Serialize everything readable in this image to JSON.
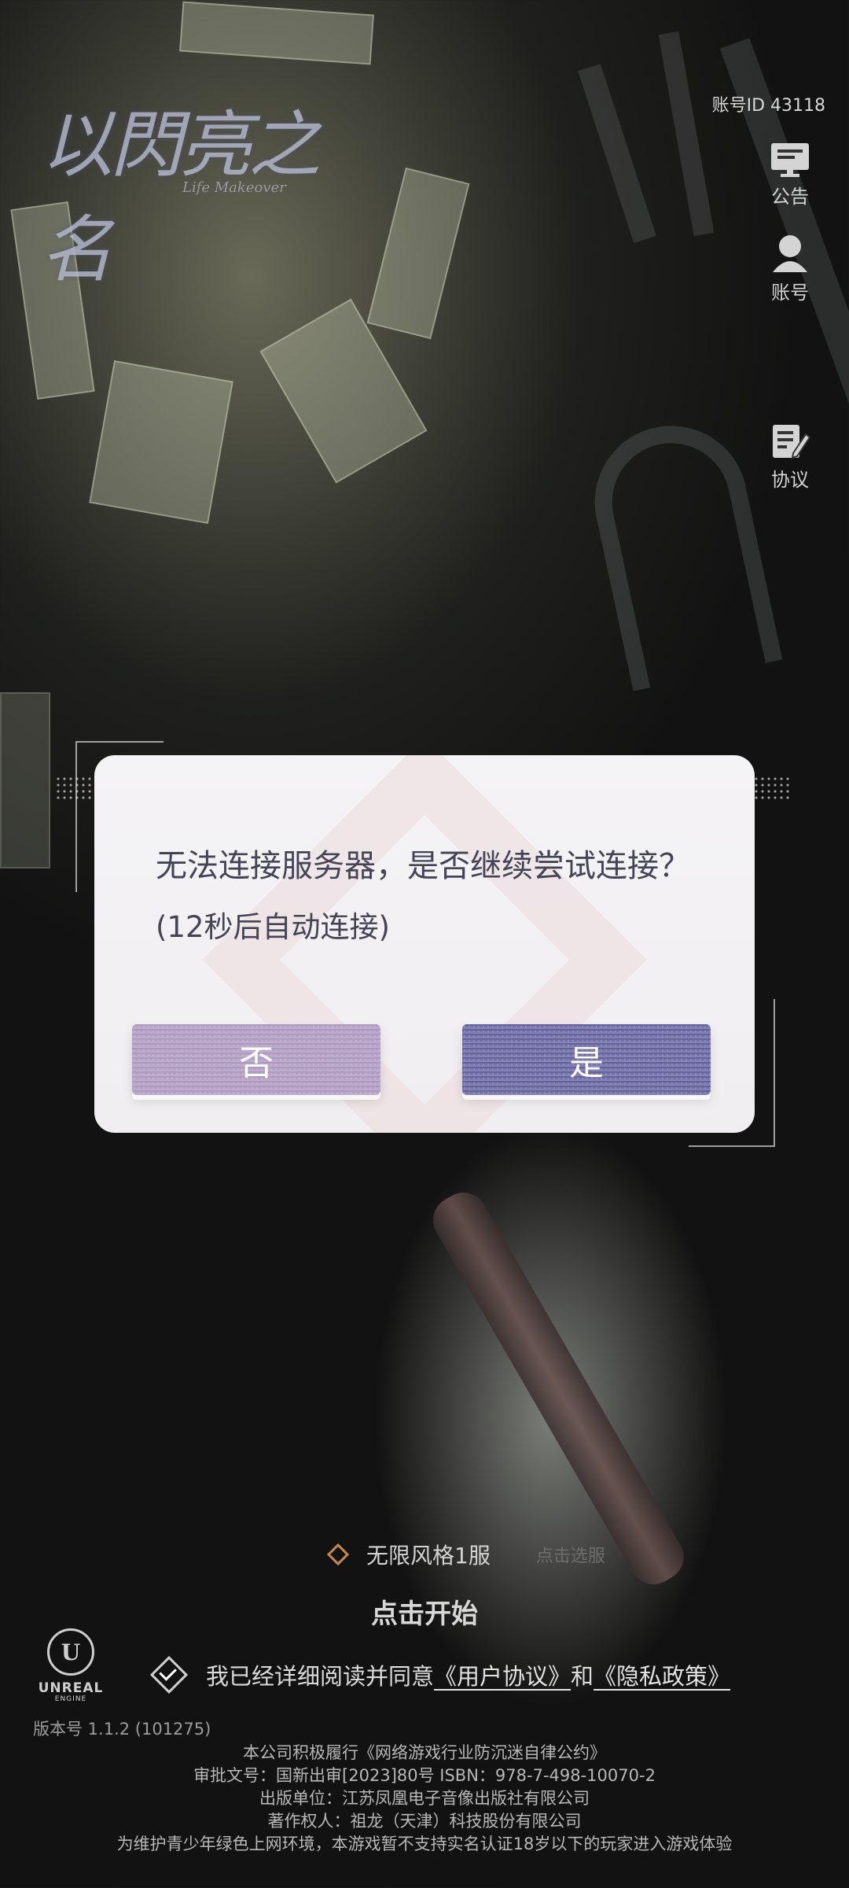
{
  "logo": {
    "main": "以閃亮之名",
    "sub": "Life Makeover"
  },
  "header": {
    "account_id": "账号ID 43118"
  },
  "side_menu": {
    "notice": "公告",
    "account": "账号",
    "agreement": "协议"
  },
  "dialog": {
    "message": "无法连接服务器，是否继续尝试连接？",
    "countdown": "(12秒后自动连接)",
    "no_label": "否",
    "yes_label": "是"
  },
  "server": {
    "name": "无限风格1服",
    "change_label": "点击选服"
  },
  "start_label": "点击开始",
  "engine": {
    "name": "UNREAL",
    "sub": "ENGINE"
  },
  "agreement": {
    "prefix": "我已经详细阅读并同意",
    "user_agreement": "《用户协议》",
    "and": "和",
    "privacy_policy": "《隐私政策》"
  },
  "version": "版本号 1.1.2 (101275)",
  "legal": {
    "line1": "本公司积极履行《网络游戏行业防沉迷自律公约》",
    "line2": "审批文号：国新出审[2023]80号 ISBN：978-7-498-10070-2",
    "line3": "出版单位：江苏凤凰电子音像出版社有限公司",
    "line4": "著作权人：祖龙（天津）科技股份有限公司",
    "line5": "为维护青少年绿色上网环境，本游戏暂不支持实名认证18岁以下的玩家进入游戏体验"
  },
  "colors": {
    "dialog_bg": "#f3f1f4",
    "button_no": "#b7a3c7",
    "button_yes": "#6f6ca6",
    "server_accent": "#c9874e"
  }
}
